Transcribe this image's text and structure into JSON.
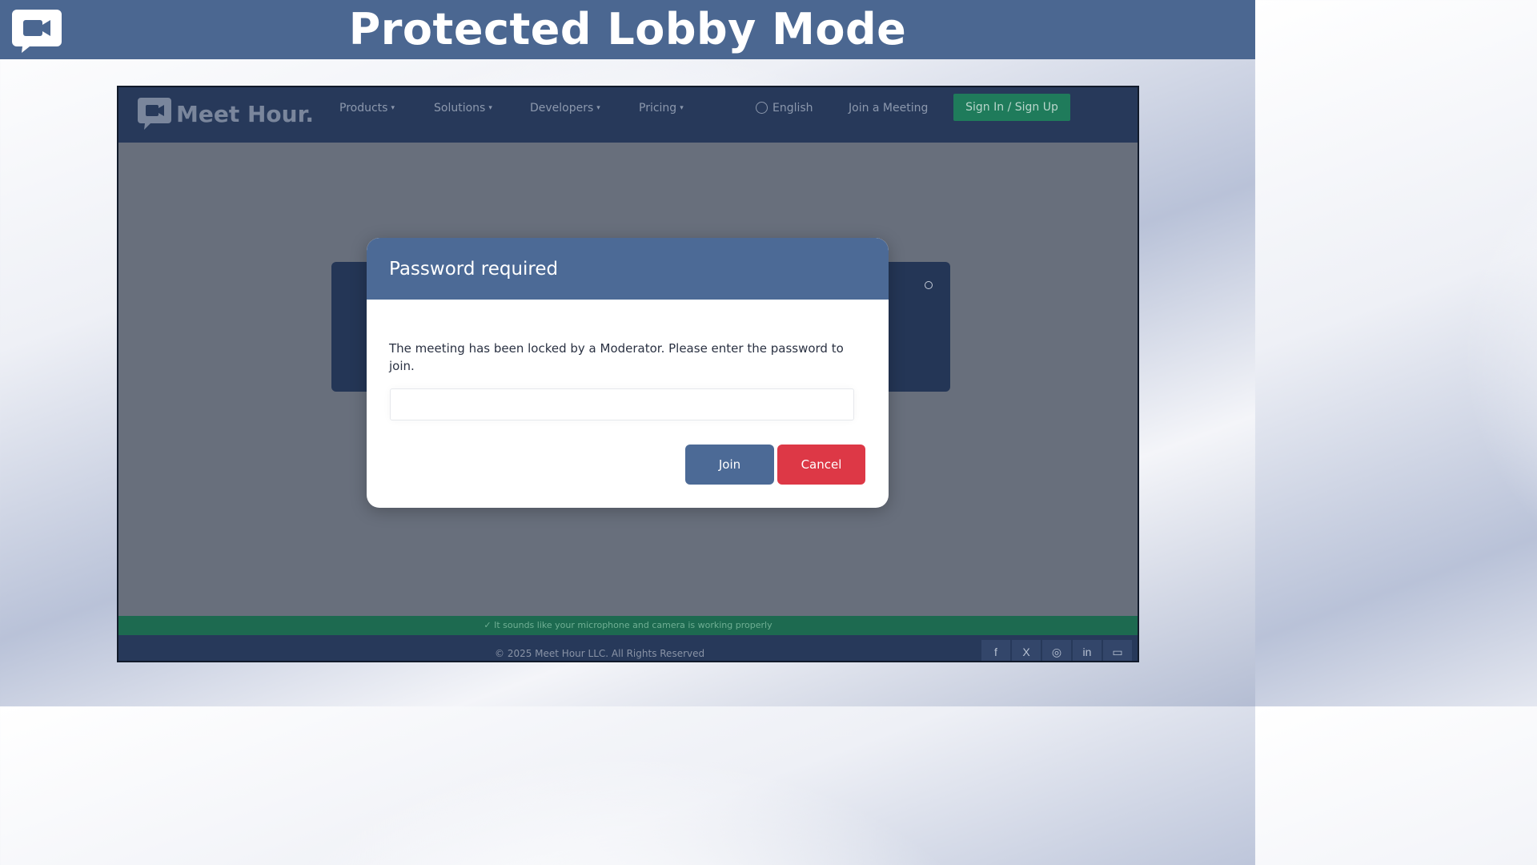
{
  "banner": {
    "title": "Protected Lobby Mode",
    "logo_icon": "chat-camera-icon",
    "color": "#4b6791"
  },
  "navbar": {
    "brand": "Meet Hour.",
    "items": [
      {
        "label": "Products",
        "has_dropdown": true
      },
      {
        "label": "Solutions",
        "has_dropdown": true
      },
      {
        "label": "Developers",
        "has_dropdown": true
      },
      {
        "label": "Pricing",
        "has_dropdown": true
      }
    ],
    "language": "English",
    "join_meeting": "Join a Meeting",
    "signin": "Sign In / Sign Up"
  },
  "modal": {
    "title": "Password required",
    "message": "The meeting has been locked by a Moderator. Please enter the password to join.",
    "password_value": "",
    "join_label": "Join",
    "cancel_label": "Cancel"
  },
  "status_bar": {
    "text": "✓ It sounds like your microphone and camera is working properly"
  },
  "footer": {
    "copyright": "© 2025 Meet Hour LLC. All Rights Reserved",
    "social": [
      {
        "icon": "facebook-icon",
        "glyph": "f"
      },
      {
        "icon": "x-twitter-icon",
        "glyph": "X"
      },
      {
        "icon": "instagram-icon",
        "glyph": "◎"
      },
      {
        "icon": "linkedin-icon",
        "glyph": "in"
      },
      {
        "icon": "email-icon",
        "glyph": "▭"
      }
    ]
  },
  "colors": {
    "brand_blue": "#4c6a96",
    "cancel_red": "#dd3846",
    "signin_green": "#1f7b5b",
    "nav_dark": "#27395a"
  }
}
